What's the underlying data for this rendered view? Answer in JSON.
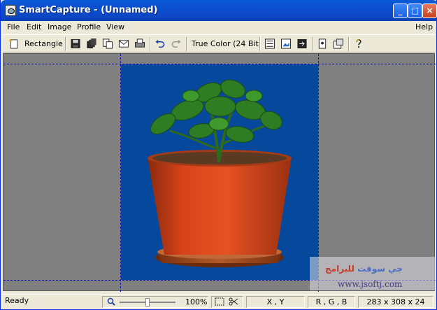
{
  "window": {
    "title": "SmartCapture - (Unnamed)"
  },
  "menu": {
    "file": "File",
    "edit": "Edit",
    "image": "Image",
    "profile": "Profile",
    "view": "View",
    "help": "Help"
  },
  "toolbar": {
    "capture_mode": "Rectangle",
    "color_mode": "True Color (24 Bit)"
  },
  "icons": [
    "new-capture-icon",
    "save-icon",
    "copy-all-icon",
    "copy-icon",
    "mail-icon",
    "print-icon",
    "undo-icon",
    "redo-icon",
    "resize-canvas-icon",
    "image-icon",
    "crop-icon",
    "properties-icon",
    "settings-icon",
    "help-icon",
    "zoom-icon",
    "fit-icon",
    "cut-icon"
  ],
  "watermark": {
    "arabic_blue": "جي سوفت",
    "arabic_red": "للبرامج",
    "url": "www.jsoftj.com"
  },
  "status": {
    "state": "Ready",
    "zoom": "100%",
    "zoom_level": 1.0,
    "coords": "X , Y",
    "rgb": "R , G , B",
    "size": "283 x 308 x 24"
  },
  "colors": {
    "canvas_bg": "#06499c",
    "title_bar": "#0a4fcf",
    "workspace": "#808080"
  }
}
